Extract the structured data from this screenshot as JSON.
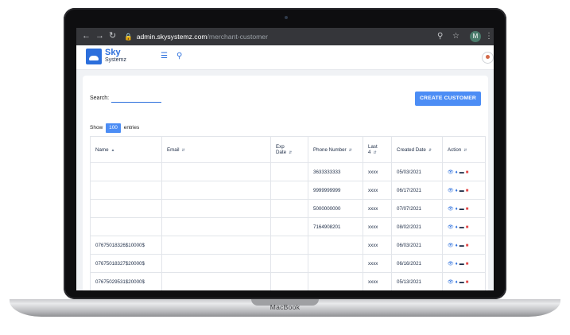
{
  "browser": {
    "url_domain": "admin.skysystemz.com",
    "url_path": "/merchant-customer",
    "profile_initial": "M"
  },
  "header": {
    "brand_line1": "Sky",
    "brand_line2": "Systemz"
  },
  "page": {
    "search_label": "Search:",
    "create_button": "CREATE CUSTOMER",
    "show_label": "Show",
    "entries_count": "100",
    "entries_label": "entries"
  },
  "table": {
    "headers": {
      "name": "Name",
      "email": "Email",
      "exp_date_1": "Exp",
      "exp_date_2": "Date",
      "phone": "Phone Number",
      "last4_1": "Last",
      "last4_2": "4",
      "created": "Created Date",
      "action": "Action"
    },
    "rows": [
      {
        "name": "",
        "email": "",
        "exp": "",
        "phone": "3633333333",
        "last4": "xxxx",
        "created": "05/03/2021"
      },
      {
        "name": "",
        "email": "",
        "exp": "",
        "phone": "9999999999",
        "last4": "xxxx",
        "created": "06/17/2021"
      },
      {
        "name": "",
        "email": "",
        "exp": "",
        "phone": "5000000000",
        "last4": "xxxx",
        "created": "07/07/2021"
      },
      {
        "name": "",
        "email": "",
        "exp": "",
        "phone": "7164908201",
        "last4": "xxxx",
        "created": "08/02/2021"
      },
      {
        "name": "07675018326$10000$",
        "email": "",
        "exp": "",
        "phone": "",
        "last4": "xxxx",
        "created": "06/03/2021"
      },
      {
        "name": "07675018327$20000$",
        "email": "",
        "exp": "",
        "phone": "",
        "last4": "xxxx",
        "created": "06/16/2021"
      },
      {
        "name": "07675029531$20000$",
        "email": "",
        "exp": "",
        "phone": "",
        "last4": "xxxx",
        "created": "05/13/2021"
      }
    ]
  },
  "device": {
    "brand": "MacBook"
  },
  "colors": {
    "accent": "#4c8df5",
    "brand": "#2c6fdc",
    "delete": "#e24a4a"
  }
}
